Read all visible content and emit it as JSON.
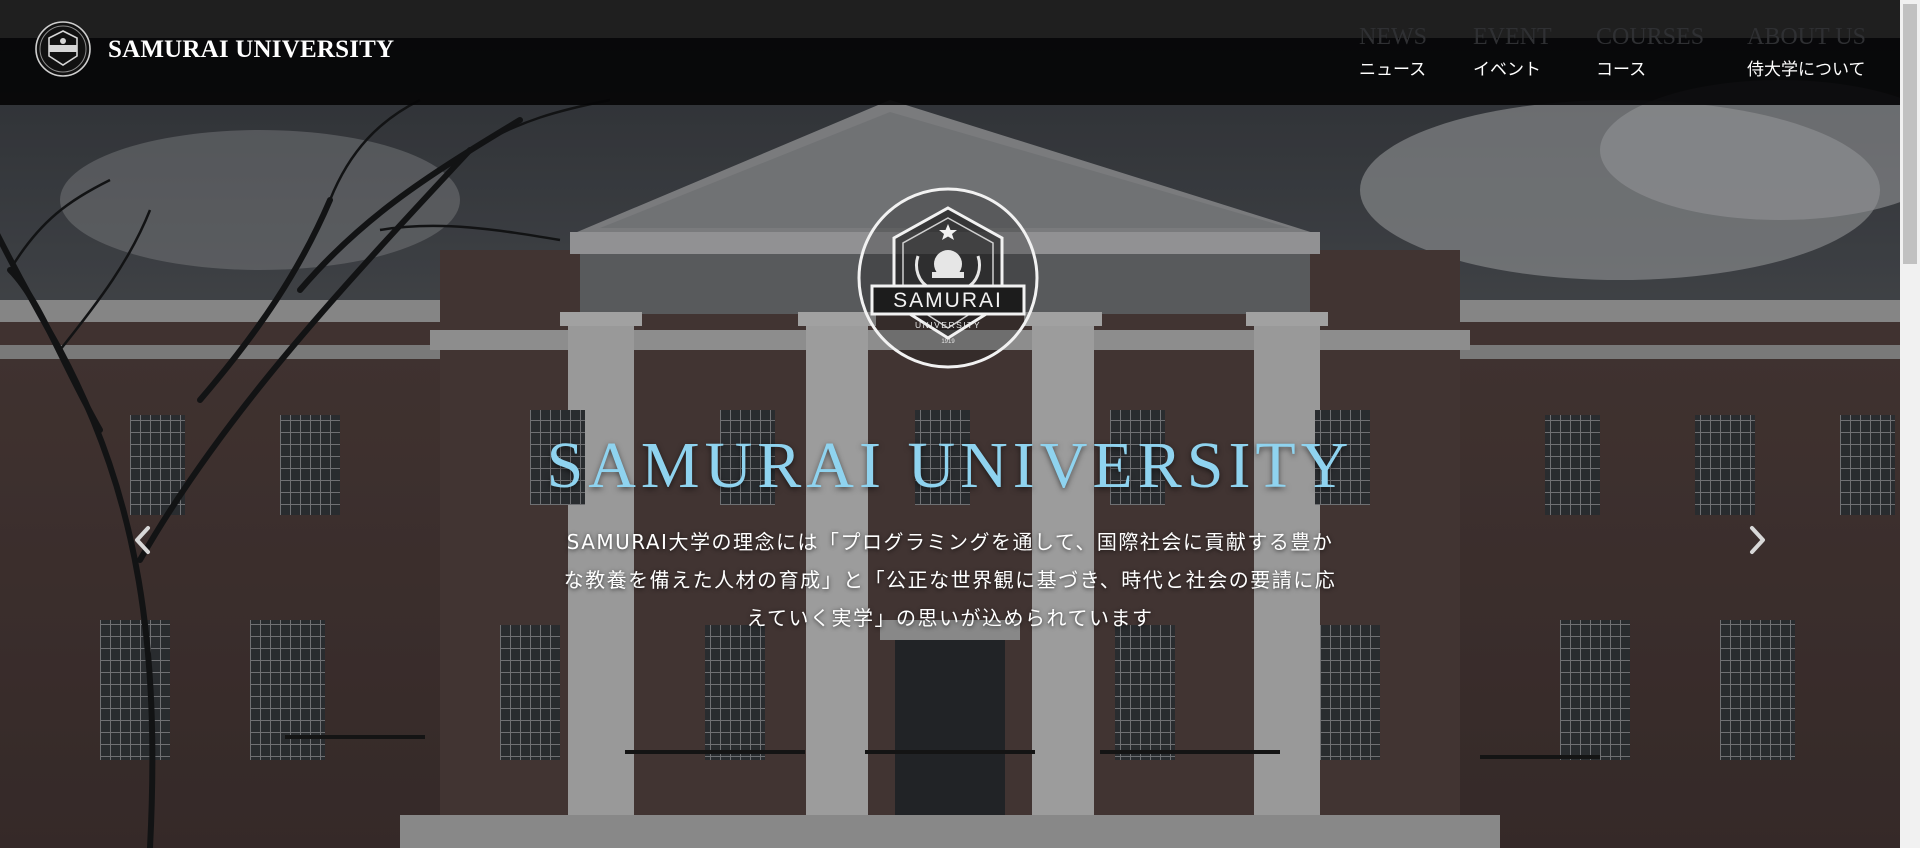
{
  "header": {
    "brand_name": "SAMURAI UNIVERSITY",
    "nav": [
      {
        "en": "NEWS",
        "ja": "ニュース"
      },
      {
        "en": "EVENT",
        "ja": "イベント"
      },
      {
        "en": "COURSES",
        "ja": "コース"
      },
      {
        "en": "ABOUT US",
        "ja": "侍大学について"
      }
    ]
  },
  "hero": {
    "emblem": {
      "wordmark": "SAMURAI",
      "subtext": "UNIVERSITY",
      "year": "1919"
    },
    "title": "SAMURAI UNIVERSITY",
    "description_lines": [
      "SAMURAI大学の理念には「プログラミングを通して、国際社会に貢献する豊か",
      "な教養を備えた人材の育成」と「公正な世界観に基づき、時代と社会の要請に応",
      "えていく実学」の思いが込められています"
    ]
  },
  "carousel": {
    "prev_icon": "chevron-left-icon",
    "next_icon": "chevron-right-icon"
  },
  "colors": {
    "title_accent": "#8fd3ef",
    "header_bg": "#050506",
    "nav_en": "#2f3033"
  }
}
